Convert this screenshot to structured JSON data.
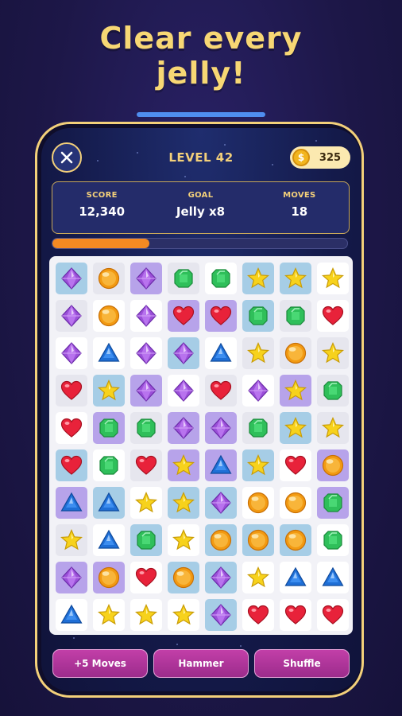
{
  "headline": {
    "line1": "Clear every",
    "line2": "jelly!"
  },
  "header": {
    "close_icon": "close-icon",
    "level_label": "LEVEL 42",
    "coins": {
      "icon": "coin-icon",
      "symbol": "$",
      "value": "325"
    }
  },
  "stats": [
    {
      "label": "SCORE",
      "value": "12,340"
    },
    {
      "label": "GOAL",
      "value": "Jelly x8"
    },
    {
      "label": "MOVES",
      "value": "18"
    }
  ],
  "progress": {
    "fraction": 0.33,
    "color": "#f58a22"
  },
  "colors": {
    "accent": "#f3d07a",
    "booster": "#b4379c",
    "jelly_blue": "#a6cde6",
    "jelly_purple": "#b7a3ea"
  },
  "board": {
    "rows": 10,
    "cols": 8,
    "legend": {
      "P": "purple-gem",
      "O": "orange-orb",
      "G": "green-gem",
      "S": "yellow-star",
      "H": "red-heart",
      "T": "blue-triangle"
    },
    "jelly_legend": {
      "0": "no-jelly",
      "1": "blue-jelly",
      "2": "purple-jelly",
      "3": "grey-tile"
    },
    "grid": [
      [
        "P",
        "O",
        "P",
        "G",
        "G",
        "S",
        "S",
        "S"
      ],
      [
        "P",
        "O",
        "P",
        "H",
        "H",
        "G",
        "G",
        "H"
      ],
      [
        "P",
        "T",
        "P",
        "P",
        "T",
        "S",
        "O",
        "S"
      ],
      [
        "H",
        "S",
        "P",
        "P",
        "H",
        "P",
        "S",
        "G"
      ],
      [
        "H",
        "G",
        "G",
        "P",
        "P",
        "G",
        "S",
        "S"
      ],
      [
        "H",
        "G",
        "H",
        "S",
        "T",
        "S",
        "H",
        "O"
      ],
      [
        "T",
        "T",
        "S",
        "S",
        "P",
        "O",
        "O",
        "G"
      ],
      [
        "S",
        "T",
        "G",
        "S",
        "O",
        "O",
        "O",
        "G"
      ],
      [
        "P",
        "O",
        "H",
        "O",
        "P",
        "S",
        "T",
        "T"
      ],
      [
        "T",
        "S",
        "S",
        "S",
        "P",
        "H",
        "H",
        "H"
      ]
    ],
    "jelly": [
      [
        1,
        3,
        2,
        3,
        0,
        1,
        1,
        0
      ],
      [
        3,
        0,
        0,
        2,
        2,
        1,
        3,
        0
      ],
      [
        0,
        0,
        0,
        1,
        0,
        3,
        3,
        3
      ],
      [
        3,
        1,
        2,
        0,
        3,
        0,
        2,
        3
      ],
      [
        0,
        2,
        3,
        2,
        2,
        3,
        1,
        3
      ],
      [
        1,
        0,
        3,
        2,
        2,
        1,
        0,
        2
      ],
      [
        2,
        1,
        0,
        1,
        1,
        0,
        0,
        2
      ],
      [
        3,
        0,
        1,
        0,
        1,
        1,
        1,
        0
      ],
      [
        2,
        2,
        0,
        1,
        1,
        0,
        0,
        0
      ],
      [
        0,
        0,
        0,
        0,
        1,
        0,
        0,
        0
      ]
    ]
  },
  "boosters": [
    {
      "label": "+5 Moves"
    },
    {
      "label": "Hammer"
    },
    {
      "label": "Shuffle"
    }
  ]
}
